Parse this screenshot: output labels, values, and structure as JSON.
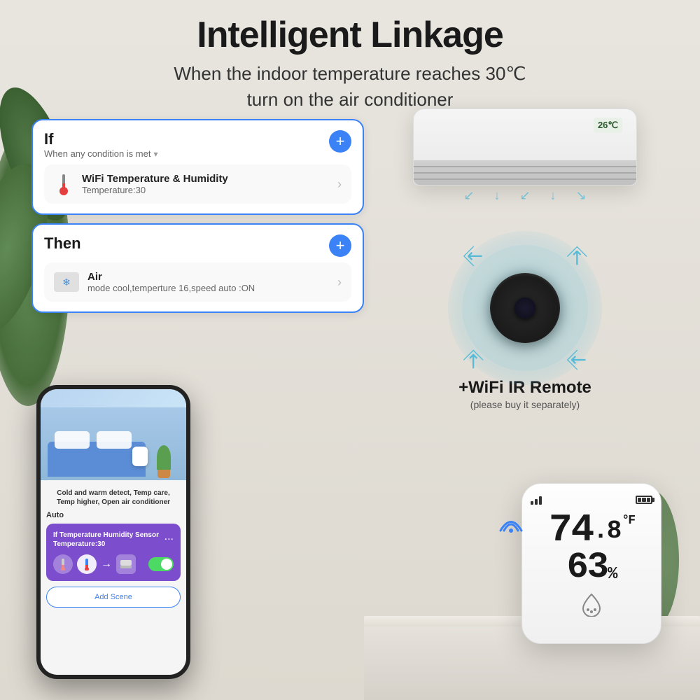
{
  "page": {
    "title": "Intelligent Linkage",
    "subtitle_line1": "When the indoor temperature reaches 30℃",
    "subtitle_line2": "turn on the air conditioner"
  },
  "if_card": {
    "title": "If",
    "subtitle": "When any condition is met",
    "chevron": "›",
    "add_button": "+",
    "condition": {
      "name": "WiFi Temperature & Humidity",
      "value": "Temperature:30"
    }
  },
  "then_card": {
    "title": "Then",
    "add_button": "+",
    "action": {
      "name": "Air",
      "value": "mode cool,temperture 16,speed auto :ON"
    }
  },
  "phone": {
    "caption": "Cold and warm detect, Temp care, Temp higher, Open air conditioner",
    "auto_label": "Auto",
    "automation_card": {
      "title": "If Temperature Humidity Sensor Temperature:30",
      "dots": "..."
    },
    "add_scene_btn": "Add Scene"
  },
  "ir_remote": {
    "label": "+WiFi IR Remote",
    "sublabel": "(please buy it separately)"
  },
  "sensor": {
    "temperature": "74",
    "temp_decimal": ".8",
    "temp_unit": "°F",
    "humidity": "63",
    "humidity_unit": "%"
  },
  "ac_unit": {
    "display_temp": "26℃"
  }
}
